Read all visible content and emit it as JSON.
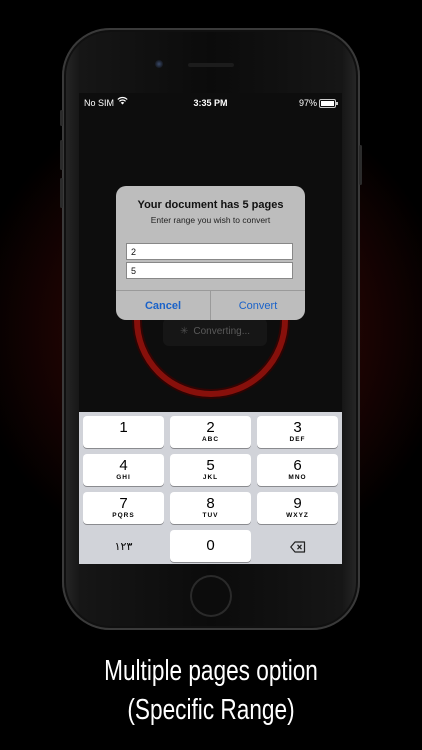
{
  "status_bar": {
    "carrier": "No SIM",
    "time": "3:35 PM",
    "battery_percent": "97%",
    "battery_level": 0.97
  },
  "background": {
    "converting_label": "Converting..."
  },
  "alert": {
    "title": "Your document has 5 pages",
    "message": "Enter range you wish to convert",
    "range_start_value": "2",
    "range_end_value": "5",
    "cancel_label": "Cancel",
    "convert_label": "Convert"
  },
  "keyboard": {
    "keys": [
      {
        "num": "1",
        "letters": ""
      },
      {
        "num": "2",
        "letters": "ABC"
      },
      {
        "num": "3",
        "letters": "DEF"
      },
      {
        "num": "4",
        "letters": "GHI"
      },
      {
        "num": "5",
        "letters": "JKL"
      },
      {
        "num": "6",
        "letters": "MNO"
      },
      {
        "num": "7",
        "letters": "PQRS"
      },
      {
        "num": "8",
        "letters": "TUV"
      },
      {
        "num": "9",
        "letters": "WXYZ"
      }
    ],
    "arabic_key": "١٢٣",
    "zero_key": "0",
    "delete_icon": "delete-backspace-icon"
  },
  "caption": {
    "line1": "Multiple pages option",
    "line2": "(Specific Range)"
  },
  "colors": {
    "accent_red": "#b5160f",
    "link_blue": "#1a62c9"
  }
}
